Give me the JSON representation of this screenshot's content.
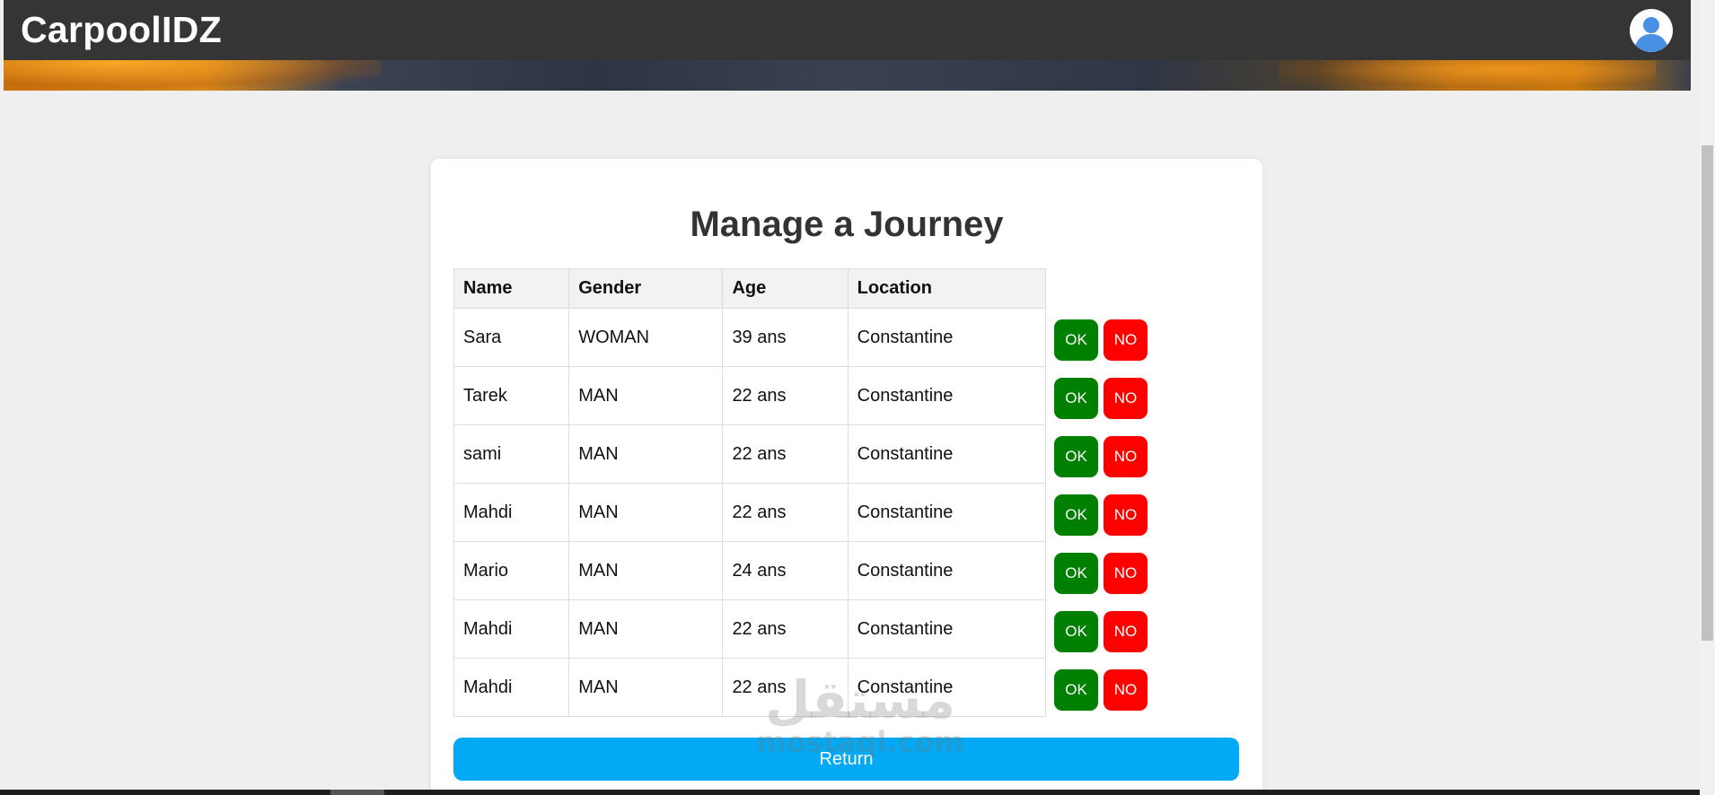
{
  "header": {
    "brand": "CarpoolIDZ",
    "avatar_icon": "user-avatar-icon"
  },
  "page": {
    "title": "Manage a Journey",
    "return_label": "Return"
  },
  "table": {
    "headers": {
      "name": "Name",
      "gender": "Gender",
      "age": "Age",
      "location": "Location"
    },
    "rows": [
      {
        "name": "Sara",
        "gender": "WOMAN",
        "age": "39 ans",
        "location": "Constantine"
      },
      {
        "name": "Tarek",
        "gender": "MAN",
        "age": "22 ans",
        "location": "Constantine"
      },
      {
        "name": "sami",
        "gender": "MAN",
        "age": "22 ans",
        "location": "Constantine"
      },
      {
        "name": "Mahdi",
        "gender": "MAN",
        "age": "22 ans",
        "location": "Constantine"
      },
      {
        "name": "Mario",
        "gender": "MAN",
        "age": "24 ans",
        "location": "Constantine"
      },
      {
        "name": "Mahdi",
        "gender": "MAN",
        "age": "22 ans",
        "location": "Constantine"
      },
      {
        "name": "Mahdi",
        "gender": "MAN",
        "age": "22 ans",
        "location": "Constantine"
      }
    ]
  },
  "actions": {
    "ok_label": "OK",
    "no_label": "NO"
  },
  "watermark": {
    "arabic": "مستقل",
    "url": "mostaql.com"
  },
  "colors": {
    "header_bg": "#353535",
    "ok": "#008000",
    "no": "#ff0000",
    "return": "#03a9f4",
    "avatar": "#4a90e2"
  }
}
